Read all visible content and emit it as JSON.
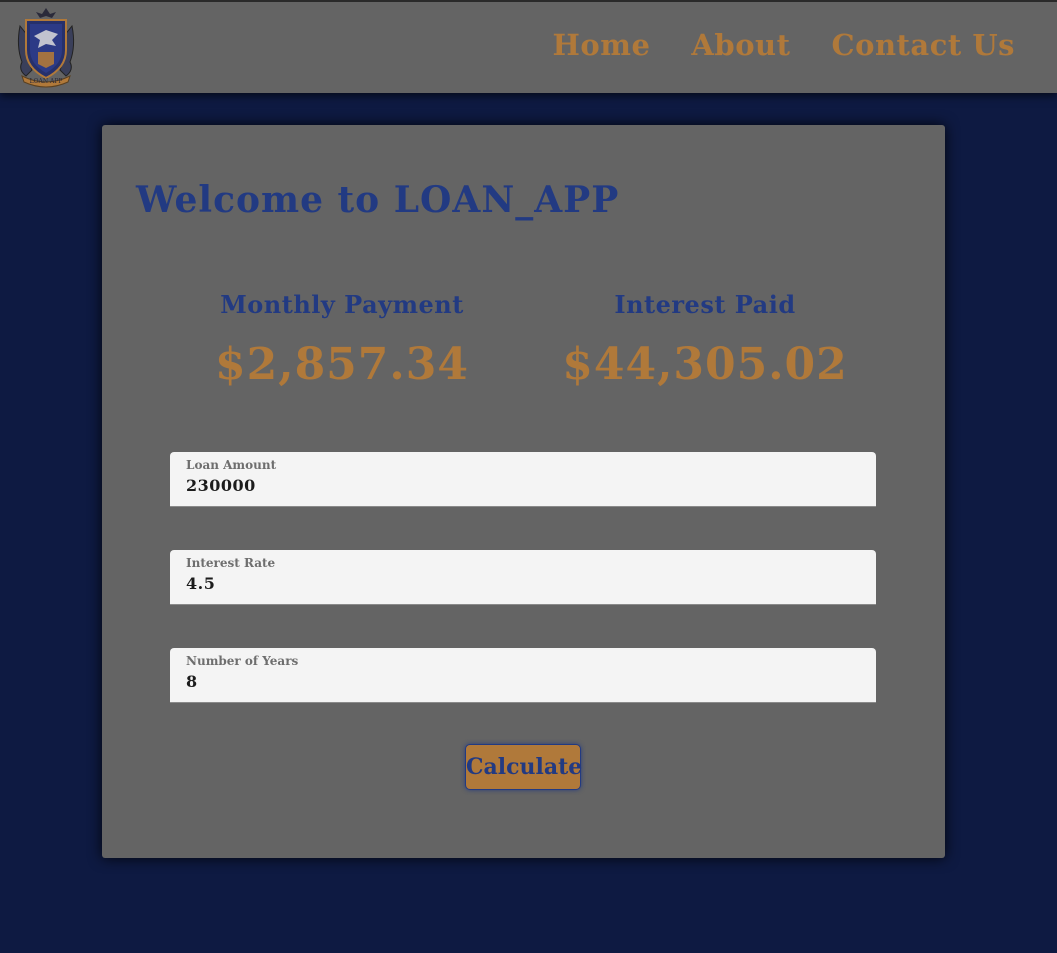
{
  "header": {
    "logo_text": "LOAN APP",
    "nav": [
      {
        "label": "Home"
      },
      {
        "label": "About"
      },
      {
        "label": "Contact Us"
      }
    ]
  },
  "main": {
    "title": "Welcome to LOAN_APP",
    "monthly_payment": {
      "label": "Monthly Payment",
      "value": "$2,857.34"
    },
    "interest_paid": {
      "label": "Interest Paid",
      "value": "$44,305.02"
    },
    "fields": [
      {
        "label": "Loan Amount",
        "value": "230000"
      },
      {
        "label": "Interest Rate",
        "value": "4.5"
      },
      {
        "label": "Number of Years",
        "value": "8"
      }
    ],
    "calculate_label": "Calculate"
  },
  "colors": {
    "background": "#0e1a42",
    "panel": "#646464",
    "accent_gold": "#b0793a",
    "accent_blue": "#223a82"
  }
}
